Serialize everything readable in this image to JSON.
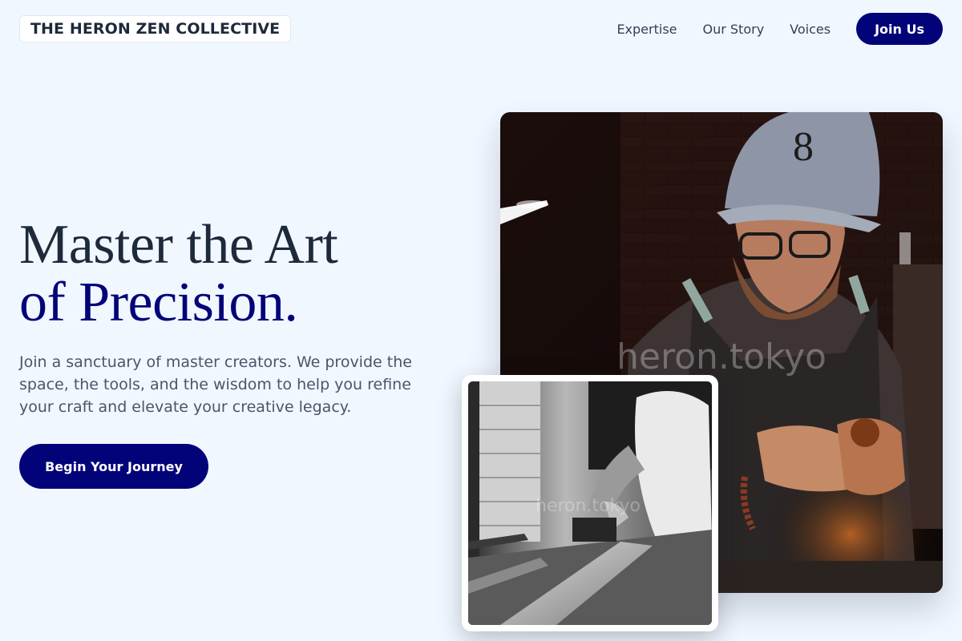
{
  "header": {
    "logo": "THE HERON ZEN COLLECTIVE",
    "nav": [
      "Expertise",
      "Our Story",
      "Voices"
    ],
    "cta": "Join Us"
  },
  "hero": {
    "title_line_1": "Master the Art",
    "title_line_2": "of Precision.",
    "description": "Join a sanctuary of master creators. We provide the space, the tools, and the wisdom to help you refine your craft and elevate your creative legacy.",
    "cta": "Begin Your Journey"
  },
  "images": {
    "main": {
      "subject": "craftsman in cap and apron carving wood",
      "watermark": "heron.tokyo"
    },
    "inset": {
      "subject": "black and white woodworker planing a board",
      "watermark": "heron.tokyo"
    }
  },
  "colors": {
    "background": "#f0f7fe",
    "accent": "#030379",
    "heading": "#1e293b",
    "body_text": "#4a5568"
  }
}
